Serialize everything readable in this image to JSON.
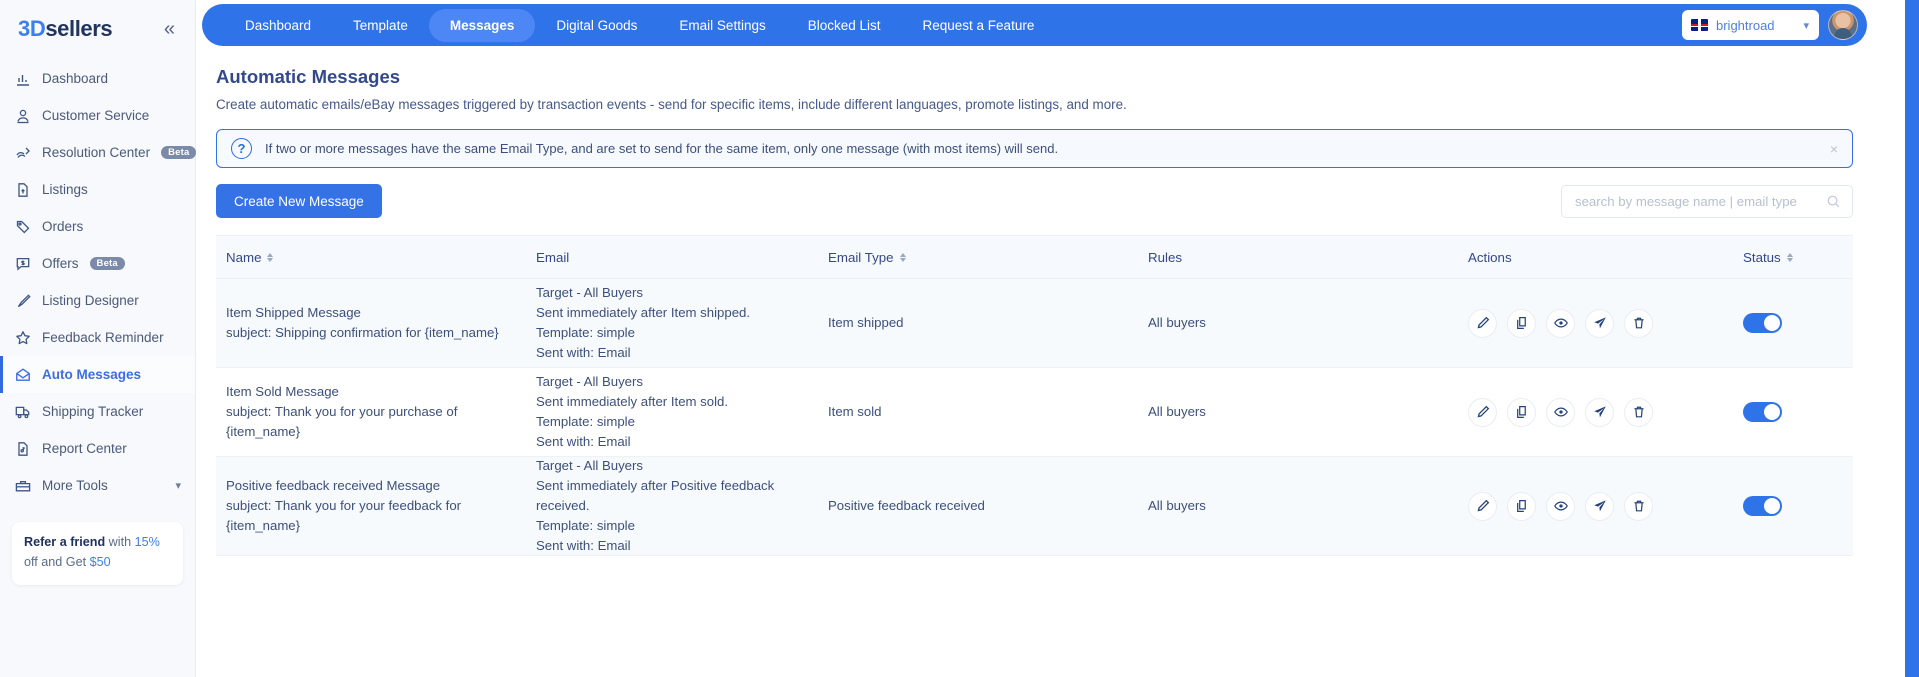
{
  "brand": {
    "part1": "3D",
    "part2": "sellers",
    "collapse_icon": "«"
  },
  "sidebar": {
    "items": [
      {
        "label": "Dashboard",
        "icon": "chart-bar-icon",
        "badge": ""
      },
      {
        "label": "Customer Service",
        "icon": "headset-person-icon",
        "badge": ""
      },
      {
        "label": "Resolution Center",
        "icon": "resolution-icon",
        "badge": "Beta"
      },
      {
        "label": "Listings",
        "icon": "document-upload-icon",
        "badge": ""
      },
      {
        "label": "Orders",
        "icon": "tag-order-icon",
        "badge": ""
      },
      {
        "label": "Offers",
        "icon": "offer-dollar-icon",
        "badge": "Beta"
      },
      {
        "label": "Listing Designer",
        "icon": "paintbrush-icon",
        "badge": ""
      },
      {
        "label": "Feedback Reminder",
        "icon": "star-icon",
        "badge": ""
      },
      {
        "label": "Auto Messages",
        "icon": "open-envelope-icon",
        "badge": ""
      },
      {
        "label": "Shipping Tracker",
        "icon": "truck-icon",
        "badge": ""
      },
      {
        "label": "Report Center",
        "icon": "report-document-icon",
        "badge": ""
      },
      {
        "label": "More Tools",
        "icon": "toolbox-icon",
        "badge": "",
        "chevron": "chevron-down-icon"
      }
    ],
    "active_item": "Auto Messages",
    "refer": {
      "bold": "Refer a friend",
      "mid": " with ",
      "percent": "15%",
      "tail": " off and Get ",
      "amount": "$50"
    }
  },
  "topbar": {
    "tabs": [
      {
        "label": "Dashboard"
      },
      {
        "label": "Template"
      },
      {
        "label": "Messages"
      },
      {
        "label": "Digital Goods"
      },
      {
        "label": "Email Settings"
      },
      {
        "label": "Blocked List"
      },
      {
        "label": "Request a Feature"
      }
    ],
    "active_tab": "Messages",
    "account": {
      "name": "brightroad",
      "flag": "uk-flag-icon",
      "chevron": "chevron-down-icon"
    },
    "avatar": "user-avatar"
  },
  "page": {
    "title": "Automatic Messages",
    "subtitle": "Create automatic emails/eBay messages triggered by transaction events - send for specific items, include different languages, promote listings, and more."
  },
  "alert": {
    "icon": "question-circle-icon",
    "text": "If two or more messages have the same Email Type, and are set to send for the same item, only one message (with most items) will send.",
    "close_icon": "×"
  },
  "toolbar": {
    "create_label": "Create New Message",
    "search_placeholder": "search by message name | email type",
    "search_value": "",
    "search_icon": "search-icon"
  },
  "table": {
    "headers": [
      {
        "label": "Name",
        "sortable": true
      },
      {
        "label": "Email",
        "sortable": false
      },
      {
        "label": "Email Type",
        "sortable": true
      },
      {
        "label": "Rules",
        "sortable": false
      },
      {
        "label": "Actions",
        "sortable": false
      },
      {
        "label": "Status",
        "sortable": true
      }
    ],
    "actions": [
      {
        "name": "edit-button",
        "icon": "pencil-icon"
      },
      {
        "name": "duplicate-button",
        "icon": "copy-icon"
      },
      {
        "name": "preview-button",
        "icon": "eye-icon"
      },
      {
        "name": "send-test-button",
        "icon": "paper-plane-icon"
      },
      {
        "name": "delete-button",
        "icon": "trash-icon"
      }
    ],
    "rows": [
      {
        "name": "Item Shipped Message",
        "subject": "subject: Shipping confirmation for {item_name}",
        "email": [
          "Target - All Buyers",
          "Sent immediately after Item shipped.",
          "Template: simple",
          "Sent with: Email"
        ],
        "email_type": "Item shipped",
        "rules": "All buyers",
        "status_on": true
      },
      {
        "name": "Item Sold Message",
        "subject": "subject: Thank you for your purchase of {item_name}",
        "email": [
          "Target - All Buyers",
          "Sent immediately after Item sold.",
          "Template: simple",
          "Sent with: Email"
        ],
        "email_type": "Item sold",
        "rules": "All buyers",
        "status_on": true
      },
      {
        "name": "Positive feedback received Message",
        "subject": "subject: Thank you for your feedback for {item_name}",
        "email": [
          "Target - All Buyers",
          "Sent immediately after Positive feedback received.",
          "Template: simple",
          "Sent with: Email"
        ],
        "email_type": "Positive feedback received",
        "rules": "All buyers",
        "status_on": true
      }
    ]
  },
  "colors": {
    "brand_blue": "#2f73e8",
    "tab_active": "#4d86f5",
    "text_navy": "#33488f",
    "sidebar_bg": "#f7f9fc",
    "row_alt": "#f7fafd",
    "toggle_on": "#2f73e8"
  }
}
